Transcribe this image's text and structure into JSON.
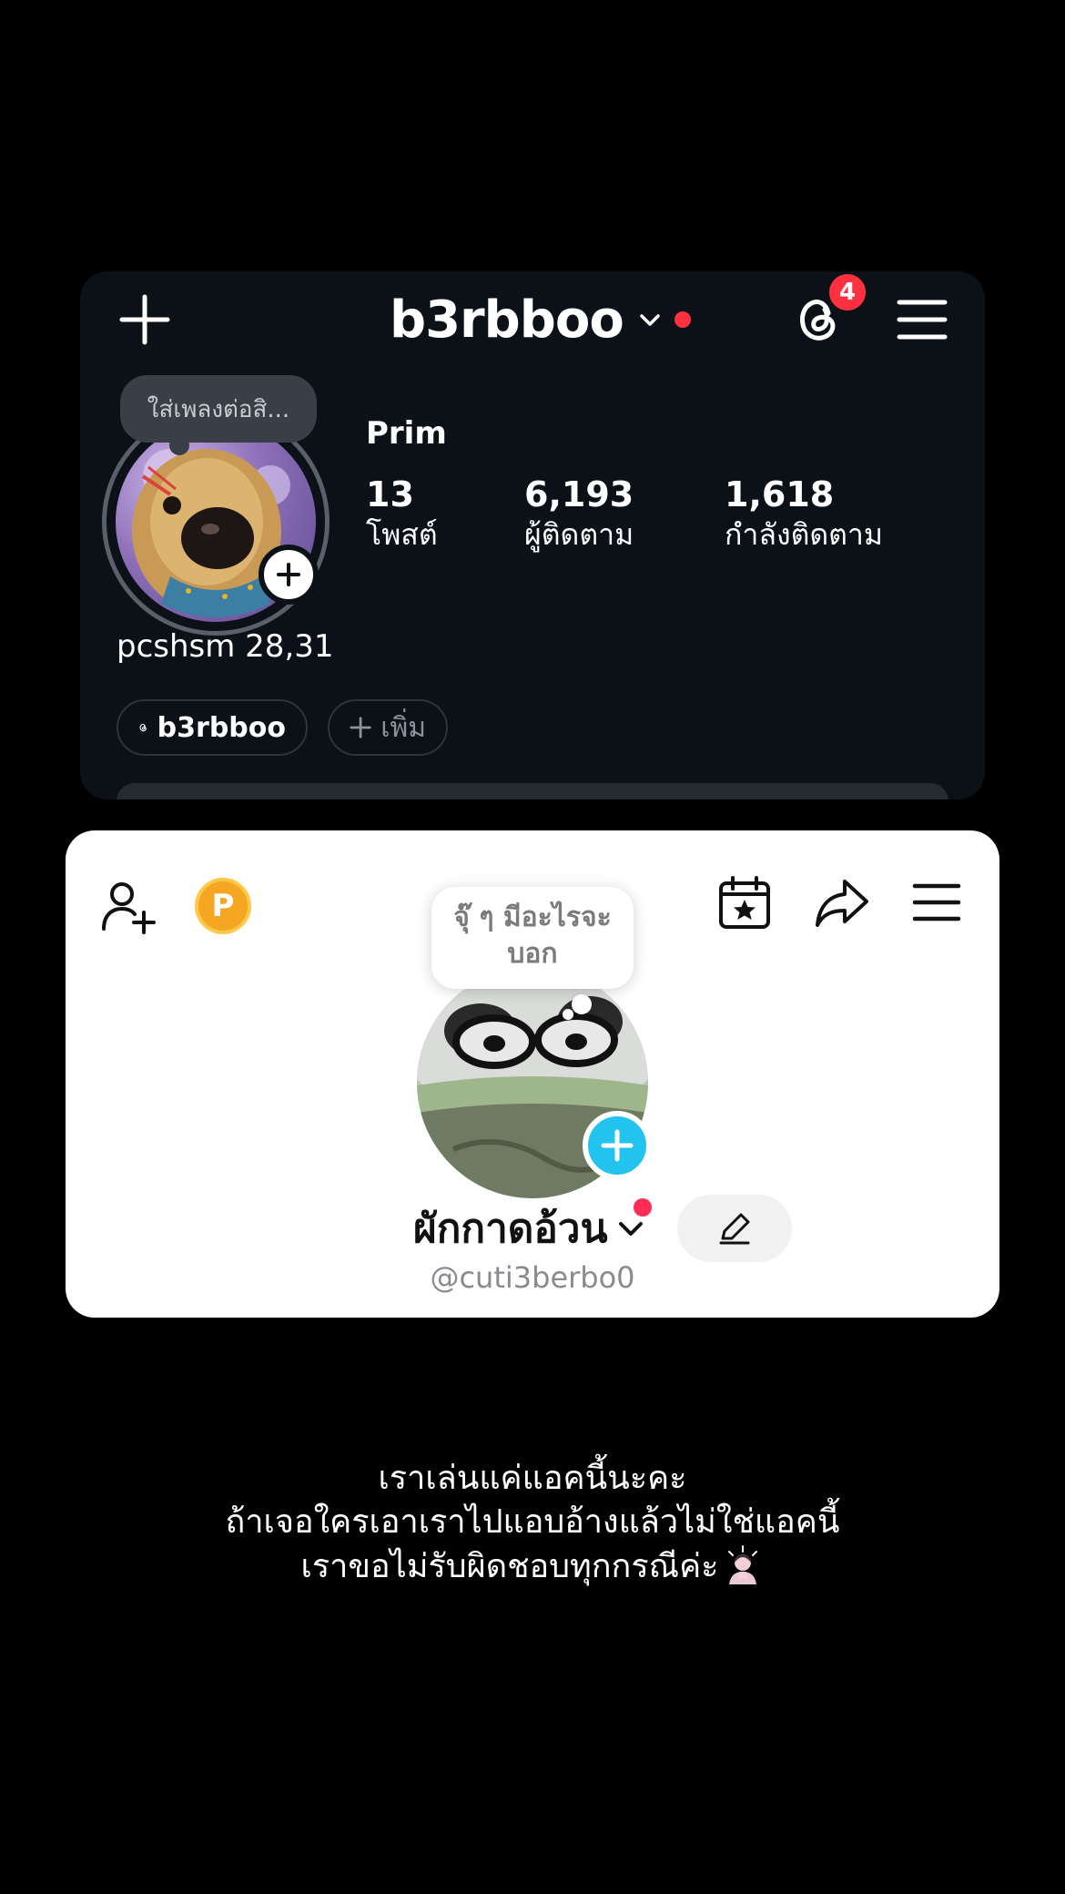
{
  "instagram": {
    "username": "b3rbboo",
    "notification_count": "4",
    "note_text": "ใส่เพลงต่อสิ...",
    "display_name": "Prim",
    "stats": [
      {
        "value": "13",
        "label": "โพสต์"
      },
      {
        "value": "6,193",
        "label": "ผู้ติดตาม"
      },
      {
        "value": "1,618",
        "label": "กำลังติดตาม"
      }
    ],
    "bio": "pcshsm 28,31",
    "threads_chip": "b3rbboo",
    "add_chip": "เพิ่ม",
    "accent_color": "#ff3040"
  },
  "tiktok": {
    "note_text": "จุ๊ ๆ มีอะไรจะบอก",
    "display_name": "ผักกาดอ้วน",
    "handle": "@cuti3berbo0",
    "coin_label": "P",
    "accent_color": "#22c3ee"
  },
  "caption": {
    "line1": "เราเล่นแค่แอคนี้นะคะ",
    "line2": "ถ้าเจอใครเอาเราไปแอบอ้างแล้วไม่ใช่แอคนี้",
    "line3": "เราขอไม่รับผิดชอบทุกกรณีค่ะ"
  }
}
